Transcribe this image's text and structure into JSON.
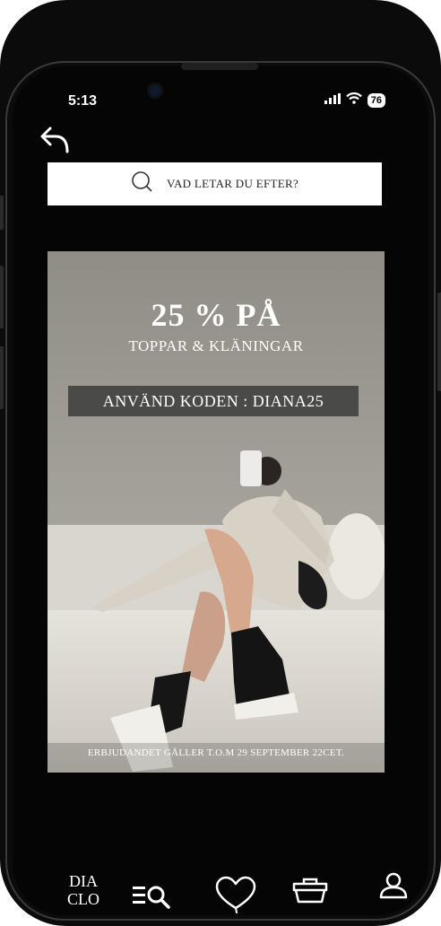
{
  "status_bar": {
    "time": "5:13",
    "battery": "76"
  },
  "search": {
    "placeholder": "VAD LETAR DU EFTER?"
  },
  "promo": {
    "headline": "25 % PÅ",
    "subheadline": "TOPPAR  & KLÄNINGAR",
    "code_text": "ANVÄND KODEN : DIANA25",
    "validity": "ERBJUDANDET  GÄLLER T.O.M 29 SEPTEMBER 22CET."
  },
  "tab_bar": {
    "logo_line1": "DIA",
    "logo_line2": "CLO",
    "icons": [
      "menu-search-icon",
      "heart-icon",
      "basket-icon",
      "user-icon"
    ]
  }
}
